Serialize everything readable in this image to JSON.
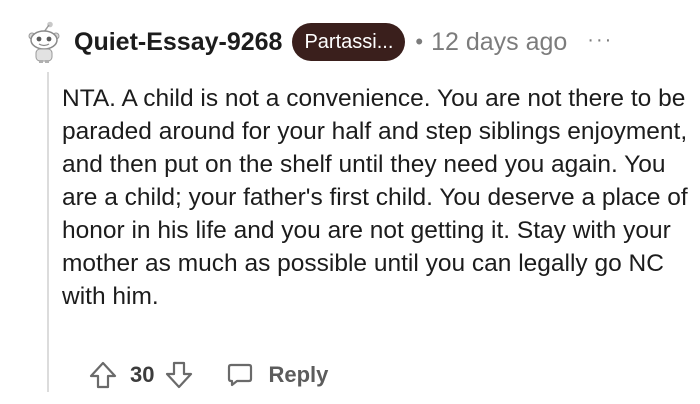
{
  "comment": {
    "username": "Quiet-Essay-9268",
    "flair": "Partassi...",
    "separator": "•",
    "timestamp": "12 days ago",
    "more_label": "···",
    "body": "NTA. A child is not a convenience. You are not there to be paraded around for your half and step siblings enjoyment, and then put on the shelf until they need you again. You are a child; your father's first child. You deserve a place of honor in his life and you are not getting it. Stay with your mother as much as possible until you can legally go NC with him.",
    "score": "30",
    "reply_label": "Reply"
  },
  "icons": {
    "avatar": "snoo-avatar-icon",
    "upvote": "arrow-up-icon",
    "downvote": "arrow-down-icon",
    "reply": "speech-bubble-icon",
    "more": "ellipsis-icon"
  },
  "colors": {
    "flair_bg": "#3a1f1c",
    "flair_text": "#ffffff",
    "meta_text": "#7c7c7c",
    "body_text": "#1c1c1c"
  }
}
